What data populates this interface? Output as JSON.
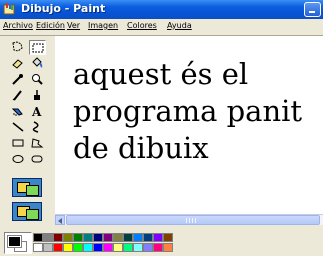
{
  "window": {
    "title": "Dibujo - Paint",
    "app_icon": "paint-app-icon",
    "minimize_icon": "minimize-icon"
  },
  "menu": {
    "items": [
      "Archivo",
      "Edición",
      "Ver",
      "Imagen",
      "Colores",
      "Ayuda"
    ]
  },
  "tools": [
    "free-select-icon",
    "rect-select-icon",
    "eraser-icon",
    "fill-bucket-icon",
    "color-picker-icon",
    "magnifier-icon",
    "pencil-icon",
    "brush-icon",
    "airbrush-icon",
    "text-tool-icon",
    "line-icon",
    "curve-icon",
    "rectangle-icon",
    "polygon-icon",
    "ellipse-icon",
    "rounded-rect-icon"
  ],
  "canvas": {
    "text_lines": [
      "aquest és el",
      "programa panit",
      "de dibuix"
    ]
  },
  "palette": {
    "foreground": "#000000",
    "background": "#ffffff",
    "row1": [
      "#000000",
      "#808080",
      "#800000",
      "#808000",
      "#008000",
      "#008080",
      "#000080",
      "#800080",
      "#808040",
      "#004040",
      "#0080ff",
      "#004080",
      "#8000ff",
      "#804000"
    ],
    "row2": [
      "#ffffff",
      "#c0c0c0",
      "#ff0000",
      "#ffff00",
      "#00ff00",
      "#00ffff",
      "#0000ff",
      "#ff00ff",
      "#ffff80",
      "#00ff80",
      "#80ffff",
      "#8080ff",
      "#ff0080",
      "#ff8040"
    ]
  }
}
